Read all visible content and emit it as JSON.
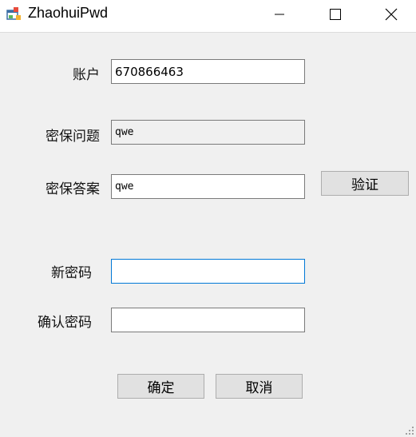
{
  "window": {
    "title": "ZhaohuiPwd",
    "icon": "app-window-icon",
    "controls": [
      "minimize-icon",
      "maximize-icon",
      "close-icon"
    ]
  },
  "form": {
    "account": {
      "label": "账户",
      "value": "670866463"
    },
    "question": {
      "label": "密保问题",
      "value": "qwe"
    },
    "answer": {
      "label": "密保答案",
      "value": "qwe"
    },
    "verify_button": "验证",
    "new_password": {
      "label": "新密码",
      "value": ""
    },
    "confirm_password": {
      "label": "确认密码",
      "value": ""
    },
    "ok_button": "确定",
    "cancel_button": "取消"
  },
  "colors": {
    "focus_border": "#0078d7",
    "window_bg": "#f0f0f0"
  }
}
